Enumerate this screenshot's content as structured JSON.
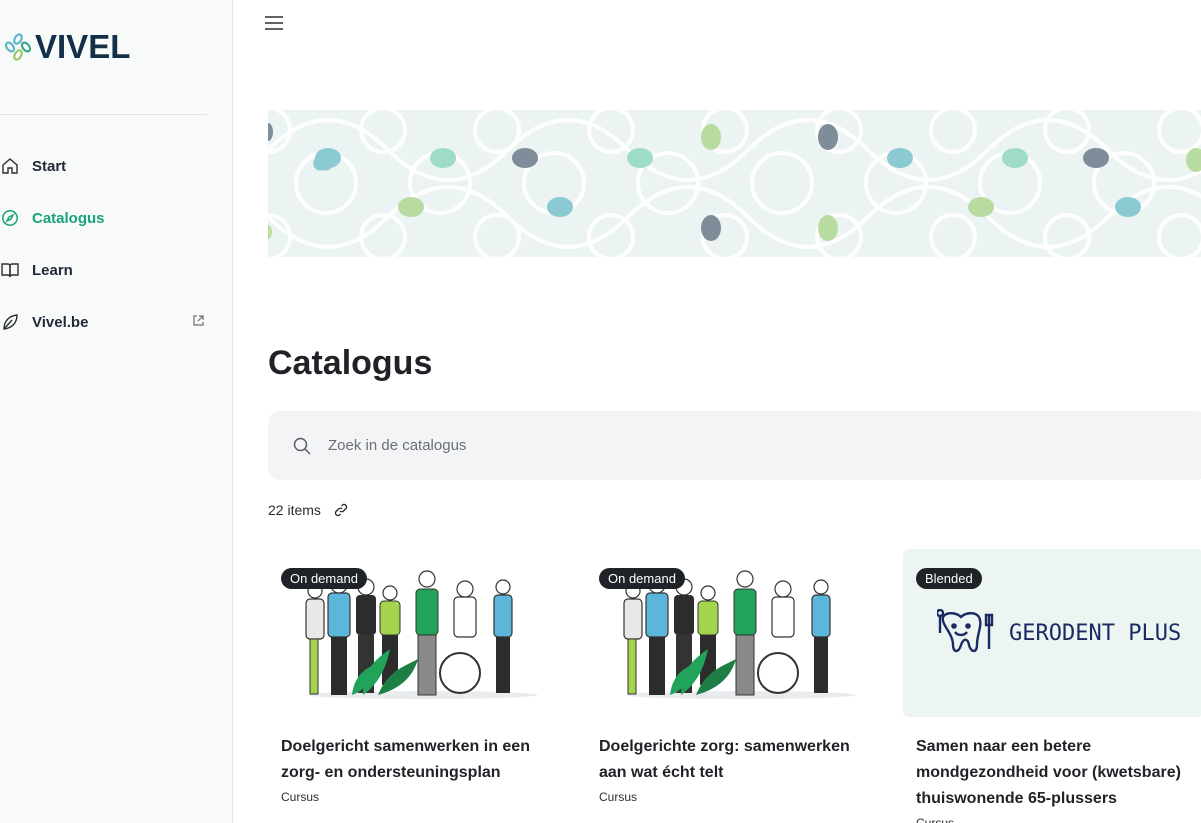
{
  "brand": {
    "name": "VIVEL"
  },
  "colors": {
    "accent": "#19a37a",
    "navy": "#13304a",
    "banner_bg": "#ecf4f3"
  },
  "sidebar": {
    "items": [
      {
        "label": "Start",
        "icon": "home-icon",
        "active": false
      },
      {
        "label": "Catalogus",
        "icon": "compass-icon",
        "active": true
      },
      {
        "label": "Learn",
        "icon": "book-icon",
        "active": false
      },
      {
        "label": "Vivel.be",
        "icon": "leaf-icon",
        "active": false,
        "external": true
      }
    ]
  },
  "header": {
    "menu_icon": "hamburger-icon"
  },
  "main": {
    "title": "Catalogus",
    "search": {
      "placeholder": "Zoek in de catalogus",
      "value": ""
    },
    "count_label": "22 items"
  },
  "cards": [
    {
      "badge": "On demand",
      "title": "Doelgericht samenwerken in een zorg- en ondersteuningsplan",
      "type": "Cursus"
    },
    {
      "badge": "On demand",
      "title": "Doelgerichte zorg: samenwerken aan wat écht telt",
      "type": "Cursus"
    },
    {
      "badge": "Blended",
      "title": "Samen naar een betere mondgezondheid voor (kwetsbare) thuiswonende 65-plussers",
      "type": "Cursus",
      "logo_text": "GERODENT PLUS"
    }
  ]
}
